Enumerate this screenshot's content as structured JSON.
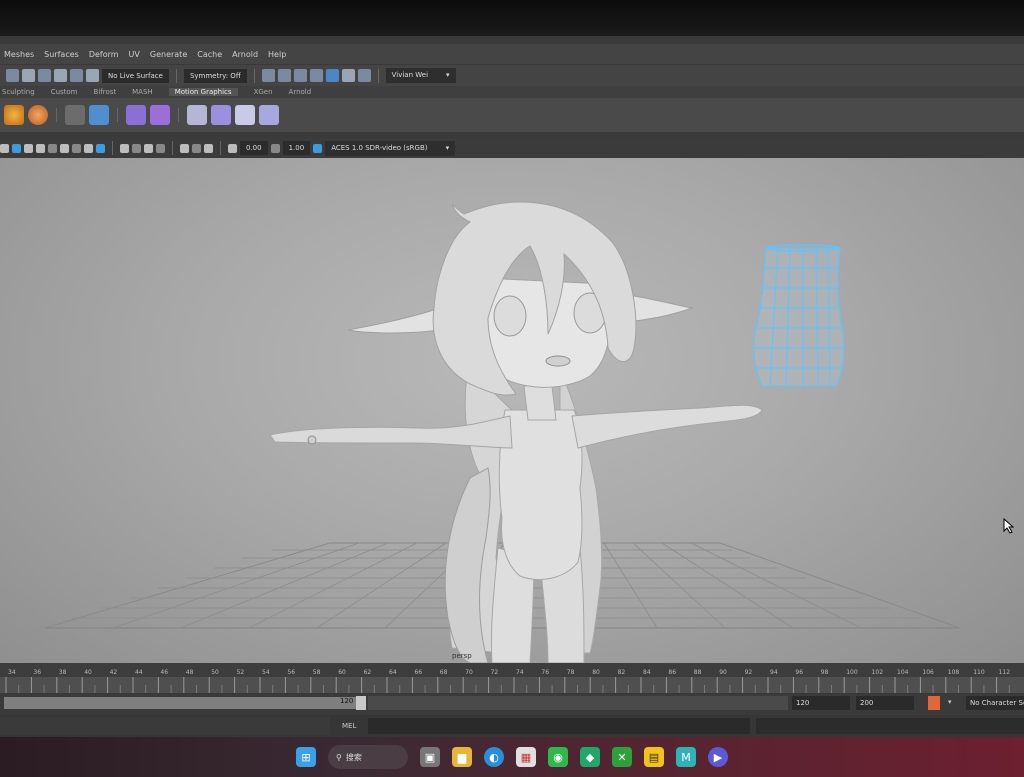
{
  "menubar": {
    "items": [
      "Meshes",
      "Surfaces",
      "Deform",
      "UV",
      "Generate",
      "Cache",
      "Arnold",
      "Help"
    ]
  },
  "statusline": {
    "live_surface": "No Live Surface",
    "symmetry": "Symmetry: Off",
    "workspace": "Vivian Wei"
  },
  "shelf_tabs": [
    "Sculpting",
    "Custom",
    "Bifrost",
    "MASH",
    "Motion Graphics",
    "XGen",
    "Arnold"
  ],
  "panel_toolbar": {
    "value_a": "0.00",
    "value_b": "1.00",
    "color_space": "ACES 1.0 SDR-video (sRGB)"
  },
  "viewport": {
    "object_label": "persp"
  },
  "timeline": {
    "ticks": [
      "34",
      "36",
      "38",
      "40",
      "42",
      "44",
      "46",
      "48",
      "50",
      "52",
      "54",
      "56",
      "58",
      "60",
      "62",
      "64",
      "66",
      "68",
      "70",
      "72",
      "74",
      "76",
      "78",
      "80",
      "82",
      "84",
      "86",
      "88",
      "90",
      "92",
      "94",
      "96",
      "98",
      "100",
      "102",
      "104",
      "106",
      "108",
      "110",
      "112"
    ]
  },
  "range": {
    "range_end": "120",
    "playback_end": "120",
    "animation_end": "200",
    "character_set": "No Character Set"
  },
  "cmdline": {
    "language": "MEL"
  },
  "taskbar": {
    "search_label": "搜索"
  },
  "colors": {
    "wireframe": "#5fc4ff",
    "viewport_bg": "#a9a9a9",
    "ui_panel": "#444444"
  }
}
